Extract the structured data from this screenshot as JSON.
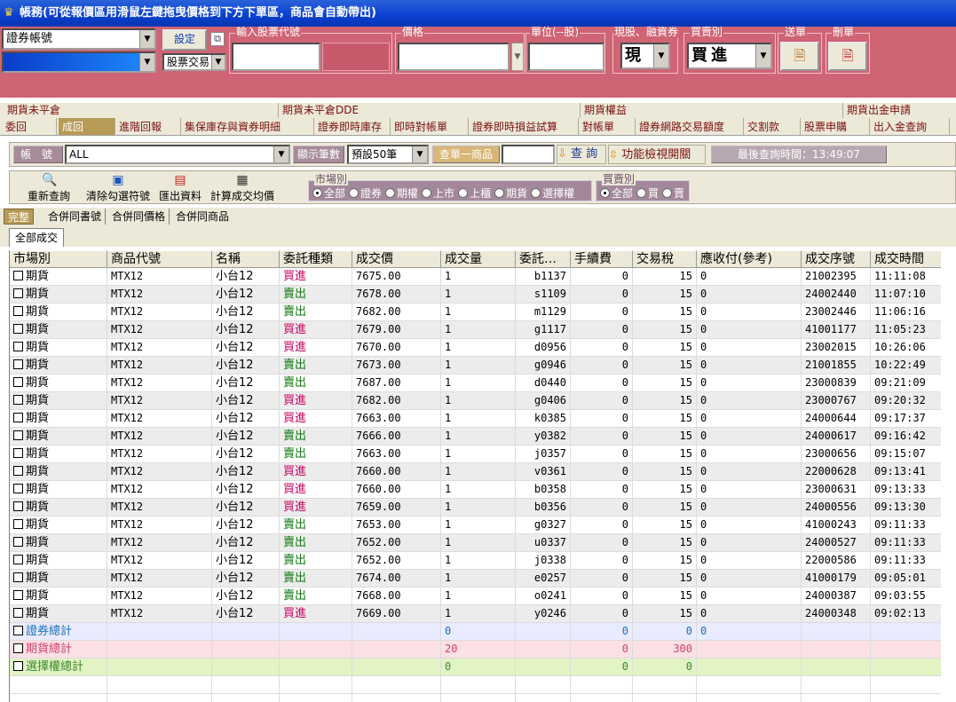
{
  "window": {
    "title": "帳務(可從報價區用滑鼠左鍵拖曳價格到下方下單區，商品會自動帶出)"
  },
  "order_panel": {
    "account_select": "證券帳號",
    "account_value": "",
    "setting_button": "設定",
    "stock_trade_select": "股票交易",
    "stock_code_label": "輸入股票代號",
    "stock_code_value": "",
    "price_label": "價格",
    "price_value": "",
    "unit_label": "單位(--股)",
    "unit_value": "",
    "cash_margin_label": "現股、融資券",
    "cash_margin_value": "現",
    "buy_sell_label": "買賣別",
    "buy_sell_value": "買進",
    "send_label": "送單",
    "delete_label": "刪單"
  },
  "menu_row1": [
    "期貨未平倉",
    "期貨未平倉DDE",
    "期貨權益",
    "期貨出金申請"
  ],
  "menu_row2": [
    "委回",
    "成回",
    "進階回報",
    "集保庫存與資券明細",
    "證券即時庫存",
    "即時對帳單",
    "證券即時損益試算",
    "對帳單",
    "證券網路交易額度",
    "交割款",
    "股票申購",
    "出入金查詢"
  ],
  "filter": {
    "account_label": "帳 號",
    "account_value": "ALL",
    "display_count_label": "顯示筆數",
    "display_count_value": "預設50筆",
    "query_single_label": "查單一商品",
    "query_single_value": "",
    "query_button": "查 詢",
    "toggle_button": "功能檢視開關",
    "last_query_label": "最後查詢時間：13:49:07"
  },
  "toolbar": {
    "refresh": "重新查詢",
    "clear_checked": "清除勾選符號",
    "export": "匯出資料",
    "avg_price": "計算成交均價",
    "market_group_label": "市場別",
    "market_options": [
      "全部",
      "證券",
      "期權",
      "上市",
      "上櫃",
      "期貨",
      "選擇權"
    ],
    "market_selected": "全部",
    "buysell_group_label": "買賣別",
    "buysell_options": [
      "全部",
      "買",
      "賣"
    ],
    "buysell_selected": "全部"
  },
  "tabs1": [
    "完整",
    "合併同書號",
    "合併同價格",
    "合併同商品"
  ],
  "tabs2": [
    "全部成交"
  ],
  "table": {
    "columns": [
      "市場別",
      "商品代號",
      "名稱",
      "委託種類",
      "成交價",
      "成交量",
      "委託…",
      "手續費",
      "交易稅",
      "應收付(參考)",
      "成交序號",
      "成交時間"
    ],
    "rows": [
      [
        "期貨",
        "MTX12",
        "小台12",
        "買進",
        "7675.00",
        "1",
        "b1137",
        "0",
        "15",
        "0",
        "21002395",
        "11:11:08"
      ],
      [
        "期貨",
        "MTX12",
        "小台12",
        "賣出",
        "7678.00",
        "1",
        "s1109",
        "0",
        "15",
        "0",
        "24002440",
        "11:07:10"
      ],
      [
        "期貨",
        "MTX12",
        "小台12",
        "賣出",
        "7682.00",
        "1",
        "m1129",
        "0",
        "15",
        "0",
        "23002446",
        "11:06:16"
      ],
      [
        "期貨",
        "MTX12",
        "小台12",
        "買進",
        "7679.00",
        "1",
        "g1117",
        "0",
        "15",
        "0",
        "41001177",
        "11:05:23"
      ],
      [
        "期貨",
        "MTX12",
        "小台12",
        "買進",
        "7670.00",
        "1",
        "d0956",
        "0",
        "15",
        "0",
        "23002015",
        "10:26:06"
      ],
      [
        "期貨",
        "MTX12",
        "小台12",
        "賣出",
        "7673.00",
        "1",
        "g0946",
        "0",
        "15",
        "0",
        "21001855",
        "10:22:49"
      ],
      [
        "期貨",
        "MTX12",
        "小台12",
        "賣出",
        "7687.00",
        "1",
        "d0440",
        "0",
        "15",
        "0",
        "23000839",
        "09:21:09"
      ],
      [
        "期貨",
        "MTX12",
        "小台12",
        "買進",
        "7682.00",
        "1",
        "g0406",
        "0",
        "15",
        "0",
        "23000767",
        "09:20:32"
      ],
      [
        "期貨",
        "MTX12",
        "小台12",
        "買進",
        "7663.00",
        "1",
        "k0385",
        "0",
        "15",
        "0",
        "24000644",
        "09:17:37"
      ],
      [
        "期貨",
        "MTX12",
        "小台12",
        "賣出",
        "7666.00",
        "1",
        "y0382",
        "0",
        "15",
        "0",
        "24000617",
        "09:16:42"
      ],
      [
        "期貨",
        "MTX12",
        "小台12",
        "賣出",
        "7663.00",
        "1",
        "j0357",
        "0",
        "15",
        "0",
        "23000656",
        "09:15:07"
      ],
      [
        "期貨",
        "MTX12",
        "小台12",
        "買進",
        "7660.00",
        "1",
        "v0361",
        "0",
        "15",
        "0",
        "22000628",
        "09:13:41"
      ],
      [
        "期貨",
        "MTX12",
        "小台12",
        "買進",
        "7660.00",
        "1",
        "b0358",
        "0",
        "15",
        "0",
        "23000631",
        "09:13:33"
      ],
      [
        "期貨",
        "MTX12",
        "小台12",
        "買進",
        "7659.00",
        "1",
        "b0356",
        "0",
        "15",
        "0",
        "24000556",
        "09:13:30"
      ],
      [
        "期貨",
        "MTX12",
        "小台12",
        "賣出",
        "7653.00",
        "1",
        "g0327",
        "0",
        "15",
        "0",
        "41000243",
        "09:11:33"
      ],
      [
        "期貨",
        "MTX12",
        "小台12",
        "賣出",
        "7652.00",
        "1",
        "u0337",
        "0",
        "15",
        "0",
        "24000527",
        "09:11:33"
      ],
      [
        "期貨",
        "MTX12",
        "小台12",
        "賣出",
        "7652.00",
        "1",
        "j0338",
        "0",
        "15",
        "0",
        "22000586",
        "09:11:33"
      ],
      [
        "期貨",
        "MTX12",
        "小台12",
        "賣出",
        "7674.00",
        "1",
        "e0257",
        "0",
        "15",
        "0",
        "41000179",
        "09:05:01"
      ],
      [
        "期貨",
        "MTX12",
        "小台12",
        "賣出",
        "7668.00",
        "1",
        "o0241",
        "0",
        "15",
        "0",
        "24000387",
        "09:03:55"
      ],
      [
        "期貨",
        "MTX12",
        "小台12",
        "買進",
        "7669.00",
        "1",
        "y0246",
        "0",
        "15",
        "0",
        "24000348",
        "09:02:13"
      ]
    ],
    "summaries": [
      {
        "label": "證券總計",
        "qty": "0",
        "fee": "0",
        "tax": "0",
        "pay": "0",
        "color": "#1d6fb8",
        "bg": "#e9ecff"
      },
      {
        "label": "期貨總計",
        "qty": "20",
        "fee": "0",
        "tax": "300",
        "pay": "",
        "color": "#d0436a",
        "bg": "#fbe0e5"
      },
      {
        "label": "選擇權總計",
        "qty": "0",
        "fee": "0",
        "tax": "0",
        "pay": "",
        "color": "#3a8a2a",
        "bg": "#e2f3c4"
      }
    ]
  },
  "colors": {
    "title_bar": "#0a3fcf",
    "order_panel": "#cf6475",
    "buy": "#c80064",
    "sell": "#127a12",
    "row_alt": "#ececec"
  }
}
